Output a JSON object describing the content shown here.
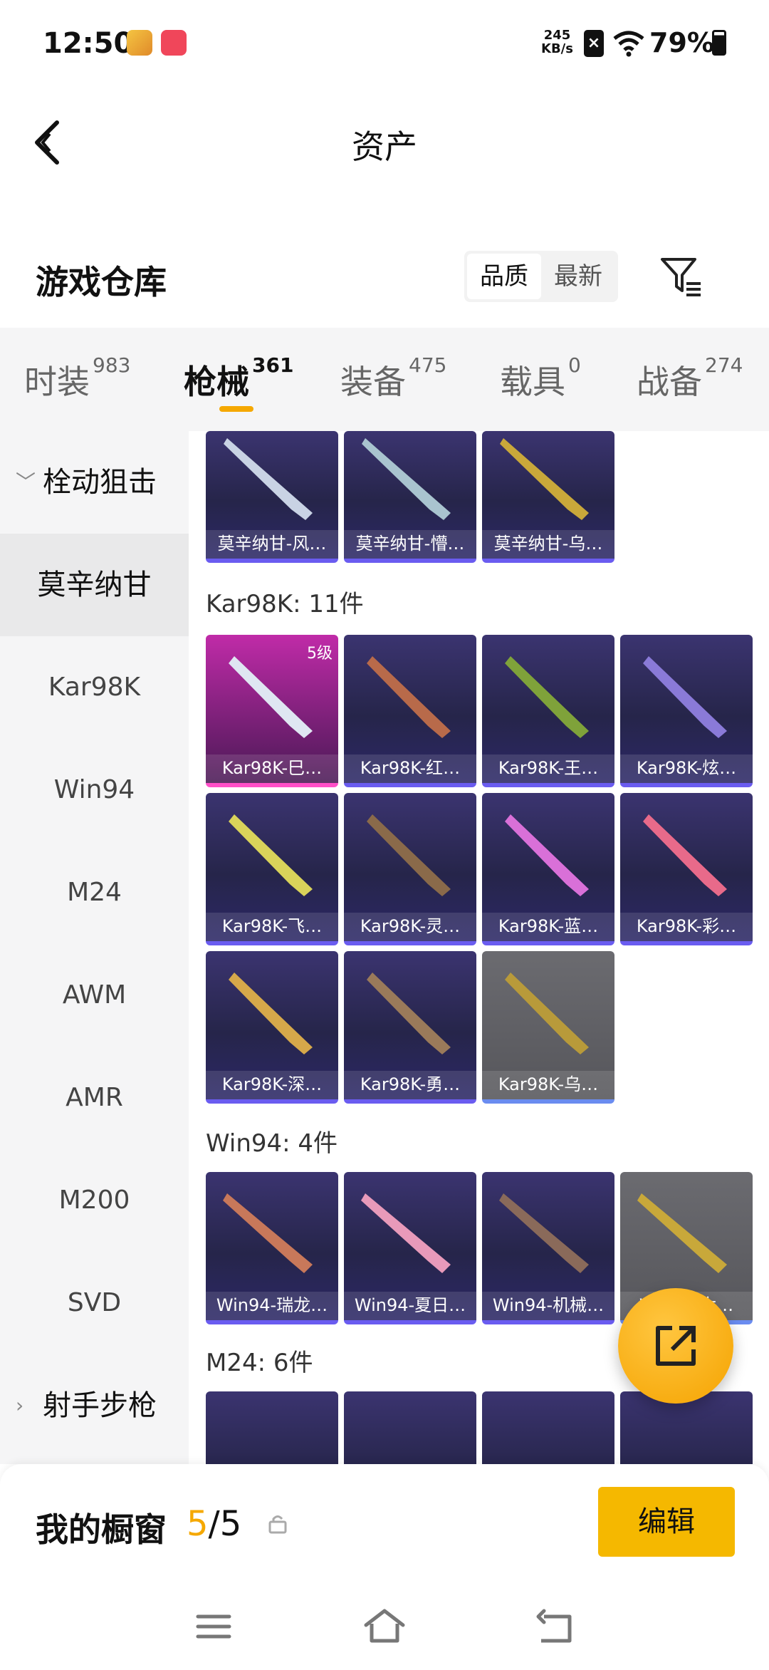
{
  "status": {
    "time": "12:50",
    "net_speed_value": "245",
    "net_speed_unit": "KB/s",
    "battery": "79%"
  },
  "header": {
    "title": "资产"
  },
  "section": {
    "title": "游戏仓库",
    "sort_quality": "品质",
    "sort_newest": "最新"
  },
  "tabs": [
    {
      "label": "时装",
      "count": "983"
    },
    {
      "label": "枪械",
      "count": "361"
    },
    {
      "label": "装备",
      "count": "475"
    },
    {
      "label": "载具",
      "count": "0"
    },
    {
      "label": "战备",
      "count": "274"
    }
  ],
  "sidebar": {
    "group_bolt": "栓动狙击",
    "items": [
      "莫辛纳甘",
      "Kar98K",
      "Win94",
      "M24",
      "AWM",
      "AMR",
      "M200",
      "SVD"
    ],
    "group_marksman": "射手步枪"
  },
  "content": {
    "mosin_cards": [
      "莫辛纳甘-风…",
      "莫辛纳甘-懵…",
      "莫辛纳甘-乌…"
    ],
    "kar98k_title": "Kar98K: 11件",
    "kar98k_level": "5级",
    "kar98k_cards": [
      "Kar98K-巳…",
      "Kar98K-红…",
      "Kar98K-王…",
      "Kar98K-炫…",
      "Kar98K-飞…",
      "Kar98K-灵…",
      "Kar98K-蓝…",
      "Kar98K-彩…",
      "Kar98K-深…",
      "Kar98K-勇…",
      "Kar98K-乌…"
    ],
    "win94_title": "Win94: 4件",
    "win94_cards": [
      "Win94-瑞龙…",
      "Win94-夏日…",
      "Win94-机械…",
      "Win94-太…"
    ],
    "m24_title": "M24: 6件"
  },
  "showcase": {
    "label": "我的橱窗",
    "current": "5",
    "total": "/5",
    "edit": "编辑"
  },
  "colors": {
    "accent": "#f5a800",
    "card_purple": "#2c2766",
    "card_pink": "#c02ba8"
  }
}
